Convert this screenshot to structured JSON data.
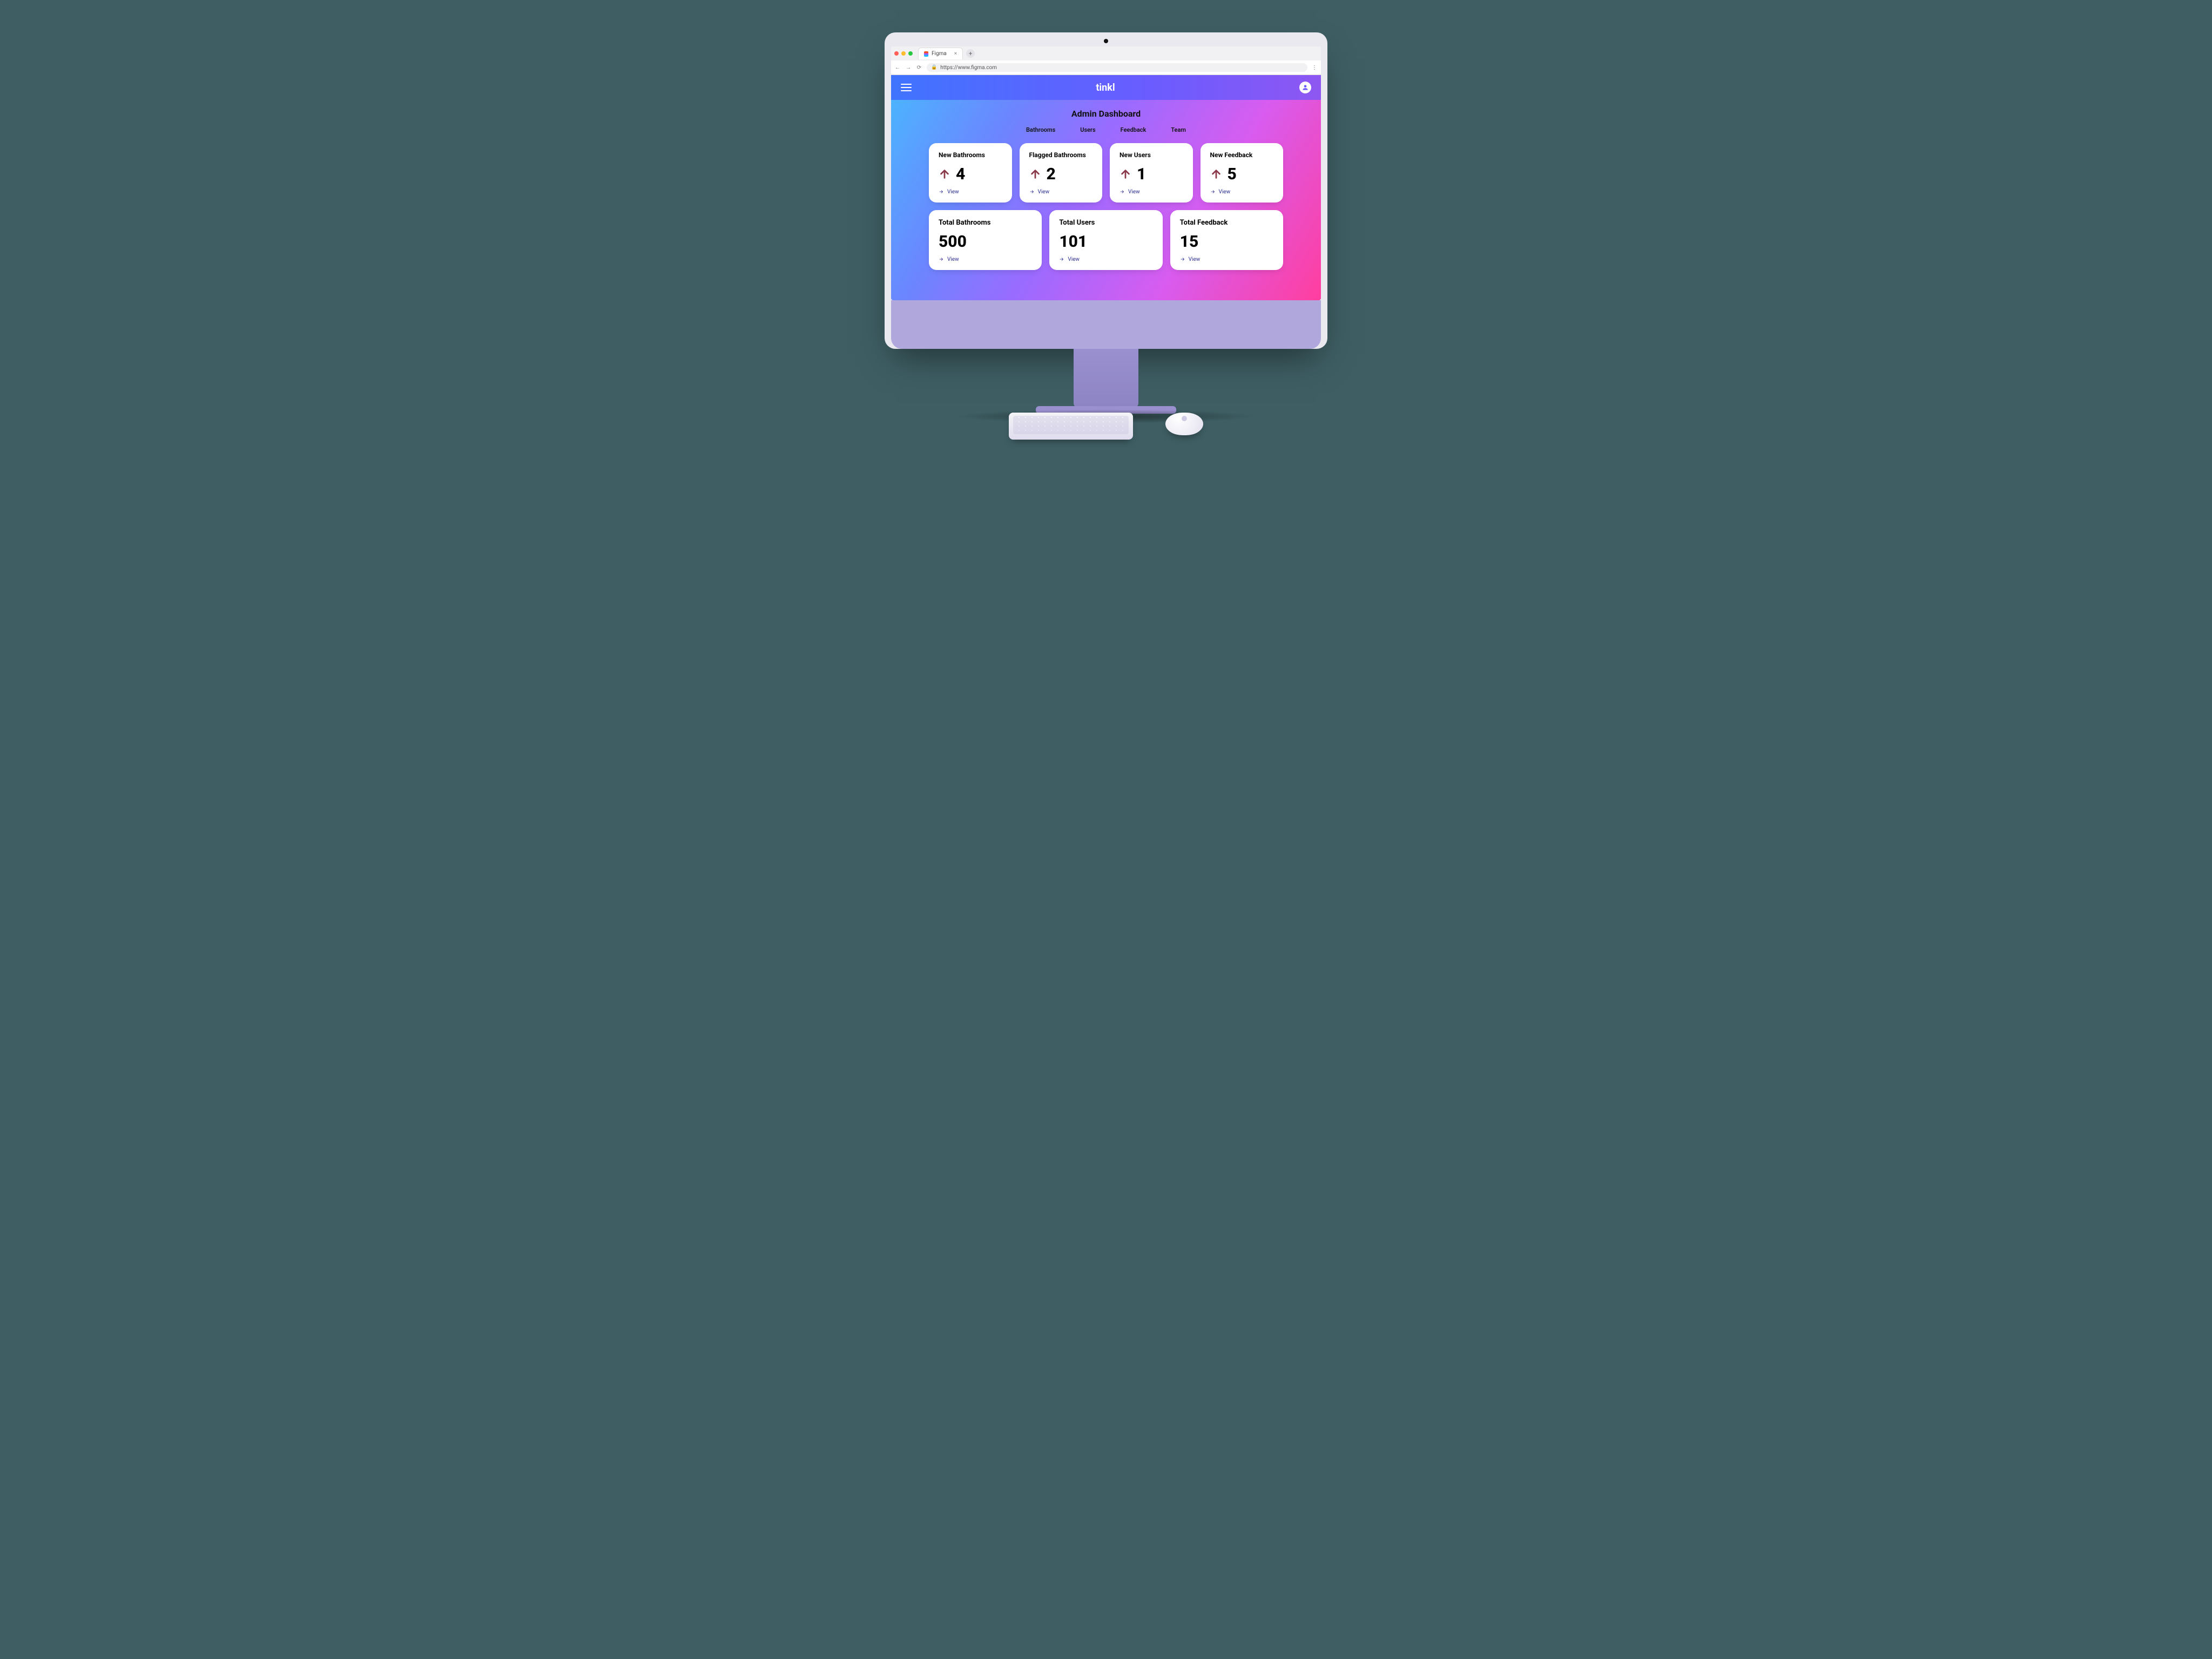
{
  "browser": {
    "tab_title": "Figma",
    "url": "https://www.figma.com",
    "new_tab_label": "+"
  },
  "header": {
    "brand": "tinkl"
  },
  "page_title": "Admin Dashboard",
  "nav_tabs": [
    "Bathrooms",
    "Users",
    "Feedback",
    "Team"
  ],
  "view_label": "View",
  "stats": [
    {
      "title": "New Bathrooms",
      "value": "4"
    },
    {
      "title": "Flagged Bathrooms",
      "value": "2"
    },
    {
      "title": "New Users",
      "value": "1"
    },
    {
      "title": "New Feedback",
      "value": "5"
    }
  ],
  "totals": [
    {
      "title": "Total Bathrooms",
      "value": "500"
    },
    {
      "title": "Total Users",
      "value": "101"
    },
    {
      "title": "Total Feedback",
      "value": "15"
    }
  ],
  "colors": {
    "arrow": "#8b3a4a",
    "link": "#2b2e8f"
  }
}
